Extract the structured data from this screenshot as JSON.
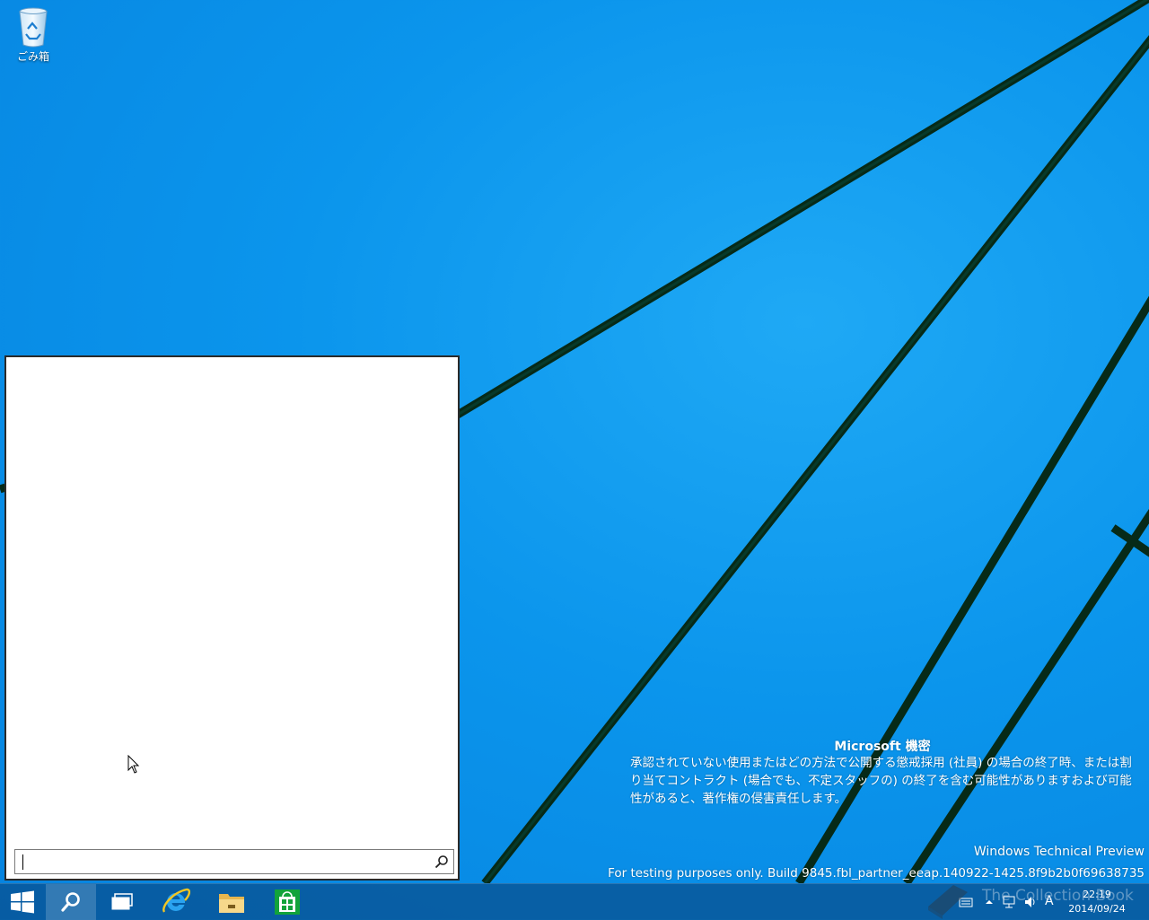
{
  "desktop": {
    "recycle_bin_label": "ごみ箱"
  },
  "search_flyout": {
    "input_value": "",
    "input_placeholder": ""
  },
  "watermark": {
    "title": "Microsoft 機密",
    "body": "承認されていない使用またはどの方法で公開する懲戒採用 (社員) の場合の終了時、または割り当てコントラクト (場合でも、不定スタッフの) の終了を含む可能性がありますおよび可能性があると、著作権の侵害責任します。",
    "edition": "Windows Technical Preview",
    "build": "For testing purposes only. Build 9845.fbl_partner_eeap.140922-1425.8f9b2b0f69638735"
  },
  "taskbar": {
    "pinned": [
      {
        "name": "start-button",
        "icon": "windows-logo-icon"
      },
      {
        "name": "search-button",
        "icon": "search-icon"
      },
      {
        "name": "task-view-button",
        "icon": "task-view-icon"
      },
      {
        "name": "internet-explorer-button",
        "icon": "internet-explorer-icon"
      },
      {
        "name": "file-explorer-button",
        "icon": "folder-icon"
      },
      {
        "name": "store-button",
        "icon": "store-icon"
      }
    ],
    "tray": {
      "ime_mode": "A",
      "time": "22:19",
      "date": "2014/09/24"
    }
  },
  "overlay_watermark": "The Collection Book",
  "colors": {
    "wallpaper_blue": "#0b95ec",
    "taskbar": "#0a4e8c",
    "store_green": "#12a33a"
  }
}
